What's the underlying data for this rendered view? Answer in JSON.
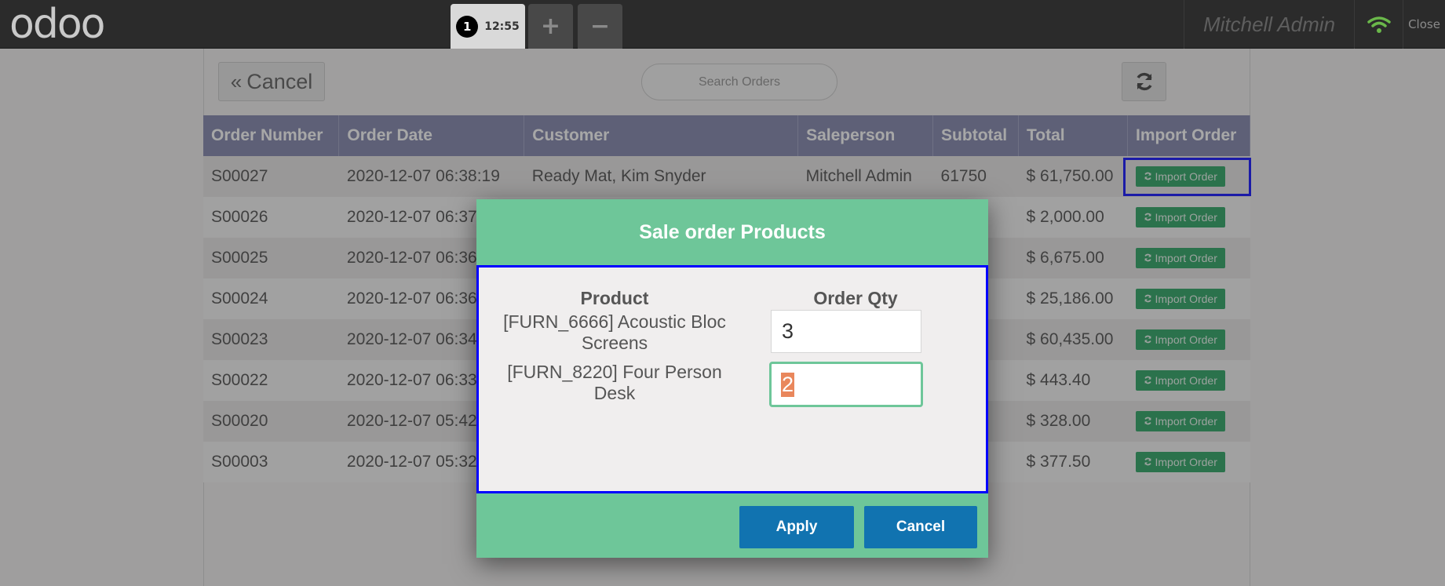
{
  "header": {
    "logo_text": "odoo",
    "order_number": "1",
    "order_time": "12:55",
    "plus_label": "+",
    "minus_label": "−",
    "user_name": "Mitchell Admin",
    "close_label": "Close",
    "wifi_color": "#6ab84a"
  },
  "toolbar": {
    "cancel_label": "Cancel",
    "search_placeholder": "Search Orders",
    "refresh_icon": "refresh-icon"
  },
  "table": {
    "columns": [
      "Order Number",
      "Order Date",
      "Customer",
      "Saleperson",
      "Subtotal",
      "Total",
      "Import Order"
    ],
    "import_button_label": "Import Order",
    "rows": [
      {
        "number": "S00027",
        "date": "2020-12-07 06:38:19",
        "customer": "Ready Mat, Kim Snyder",
        "saleperson": "Mitchell Admin",
        "subtotal": "61750",
        "total": "$ 61,750.00"
      },
      {
        "number": "S00026",
        "date": "2020-12-07 06:37",
        "customer": "",
        "saleperson": "",
        "subtotal": "",
        "total": "$ 2,000.00"
      },
      {
        "number": "S00025",
        "date": "2020-12-07 06:36",
        "customer": "",
        "saleperson": "",
        "subtotal": "",
        "total": "$ 6,675.00"
      },
      {
        "number": "S00024",
        "date": "2020-12-07 06:36",
        "customer": "",
        "saleperson": "",
        "subtotal": "",
        "total": "$ 25,186.00"
      },
      {
        "number": "S00023",
        "date": "2020-12-07 06:34",
        "customer": "",
        "saleperson": "",
        "subtotal": "",
        "total": "$ 60,435.00"
      },
      {
        "number": "S00022",
        "date": "2020-12-07 06:33",
        "customer": "",
        "saleperson": "",
        "subtotal": "",
        "total": "$ 443.40"
      },
      {
        "number": "S00020",
        "date": "2020-12-07 05:42",
        "customer": "",
        "saleperson": "",
        "subtotal": "",
        "total": "$ 328.00"
      },
      {
        "number": "S00003",
        "date": "2020-12-07 05:32",
        "customer": "",
        "saleperson": "",
        "subtotal": "",
        "total": "$ 377.50"
      }
    ]
  },
  "modal": {
    "title": "Sale order Products",
    "product_header": "Product",
    "qty_header": "Order Qty",
    "lines": [
      {
        "product": "[FURN_6666] Acoustic Bloc Screens",
        "qty": "3"
      },
      {
        "product": "[FURN_8220] Four Person Desk",
        "qty": "2"
      }
    ],
    "apply_label": "Apply",
    "cancel_label": "Cancel",
    "accent_color": "#6ec699",
    "button_color": "#1173b0"
  }
}
